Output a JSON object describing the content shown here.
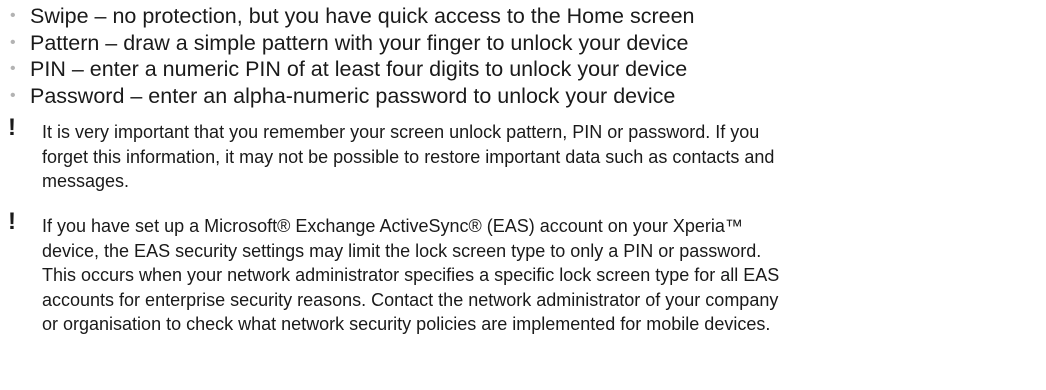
{
  "lock_options": {
    "bullet_symbol": "•",
    "items": [
      {
        "label": "Swipe – no protection, but you have quick access to the Home screen"
      },
      {
        "label": "Pattern – draw a simple pattern with your finger to unlock your device"
      },
      {
        "label": "PIN – enter a numeric PIN of at least four digits to unlock your device"
      },
      {
        "label": "Password – enter an alpha-numeric password to unlock your device"
      }
    ]
  },
  "notes": [
    {
      "icon": "!",
      "lines": [
        "It is very important that you remember your screen unlock pattern, PIN or password. If you",
        "forget this information, it may not be possible to restore important data such as contacts and",
        "messages."
      ]
    },
    {
      "icon": "!",
      "lines": [
        "If you have set up a Microsoft® Exchange ActiveSync® (EAS) account on your Xperia™",
        "device, the EAS security settings may limit the lock screen type to only a PIN or password.",
        "This occurs when your network administrator specifies a specific lock screen type for all EAS",
        "accounts for enterprise security reasons. Contact the network administrator of your company",
        "or organisation to check what network security policies are implemented for mobile devices."
      ]
    }
  ]
}
